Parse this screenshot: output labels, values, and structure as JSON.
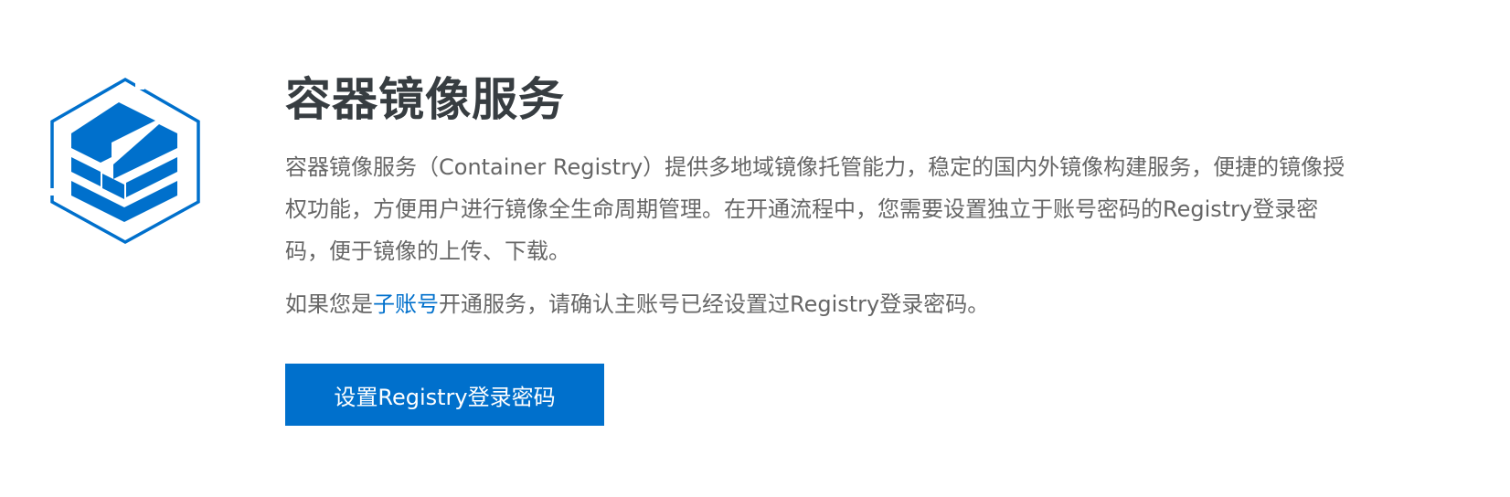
{
  "service": {
    "title": "容器镜像服务",
    "description": "容器镜像服务（Container Registry）提供多地域镜像托管能力，稳定的国内外镜像构建服务，便捷的镜像授权功能，方便用户进行镜像全生命周期管理。在开通流程中，您需要设置独立于账号密码的Registry登录密码，便于镜像的上传、下载。",
    "note_prefix": "如果您是",
    "note_link": "子账号",
    "note_suffix": "开通服务，请确认主账号已经设置过Registry登录密码。",
    "button_label": "设置Registry登录密码",
    "logo_icon": "container-registry-cube-icon"
  },
  "colors": {
    "accent": "#0070cc",
    "title": "#373d41",
    "body_text": "#666666",
    "background": "#ffffff"
  }
}
